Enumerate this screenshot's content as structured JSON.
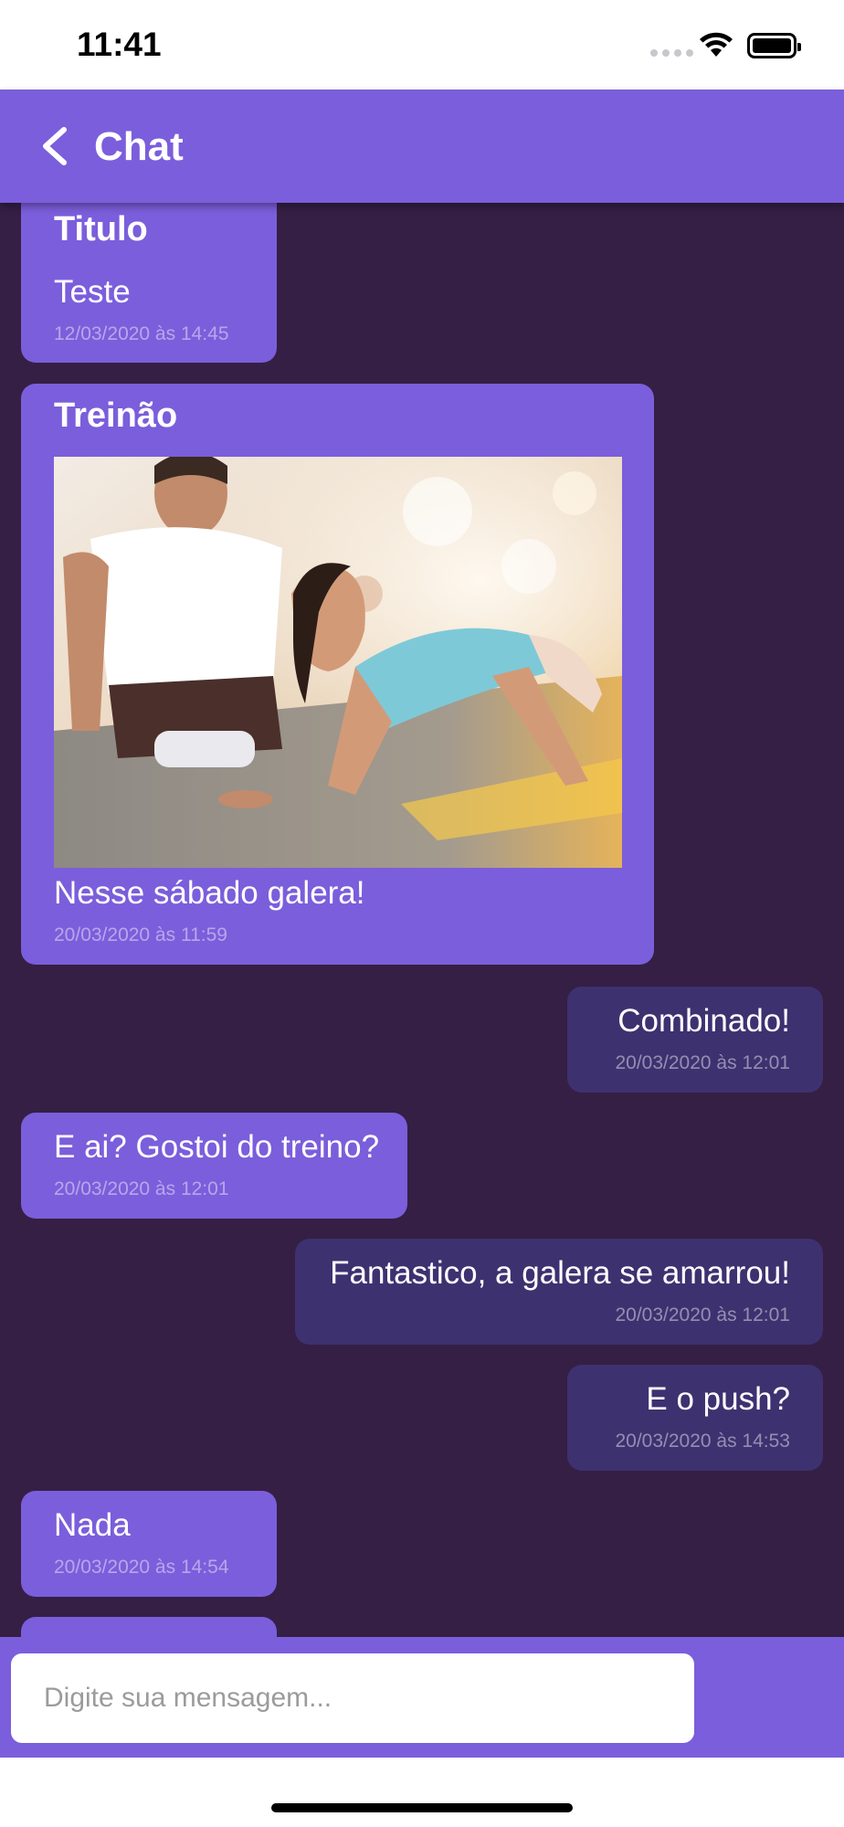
{
  "status_bar": {
    "time": "11:41"
  },
  "header": {
    "title": "Chat"
  },
  "messages": [
    {
      "direction": "incoming",
      "title": "Titulo",
      "text": "Teste",
      "time": "12/03/2020 às 14:45"
    },
    {
      "direction": "incoming",
      "title": "Treinão",
      "image": "woman doing push-ups with trainer",
      "text": "Nesse sábado galera!",
      "time": "20/03/2020 às 11:59"
    },
    {
      "direction": "outgoing",
      "text": "Combinado!",
      "time": "20/03/2020 às 12:01"
    },
    {
      "direction": "incoming",
      "text": "E ai? Gostoi do treino?",
      "time": "20/03/2020 às 12:01"
    },
    {
      "direction": "outgoing",
      "text": "Fantastico, a galera se amarrou!",
      "time": "20/03/2020 às 12:01"
    },
    {
      "direction": "outgoing",
      "text": "E o push?",
      "time": "20/03/2020 às 14:53"
    },
    {
      "direction": "incoming",
      "text": "Nada",
      "time": "20/03/2020 às 14:54"
    }
  ],
  "composer": {
    "placeholder": "Digite sua mensagem..."
  },
  "colors": {
    "header": "#7b5edb",
    "background": "#351f45",
    "incoming_bubble": "#7b5edb",
    "outgoing_bubble": "#3e3170"
  }
}
